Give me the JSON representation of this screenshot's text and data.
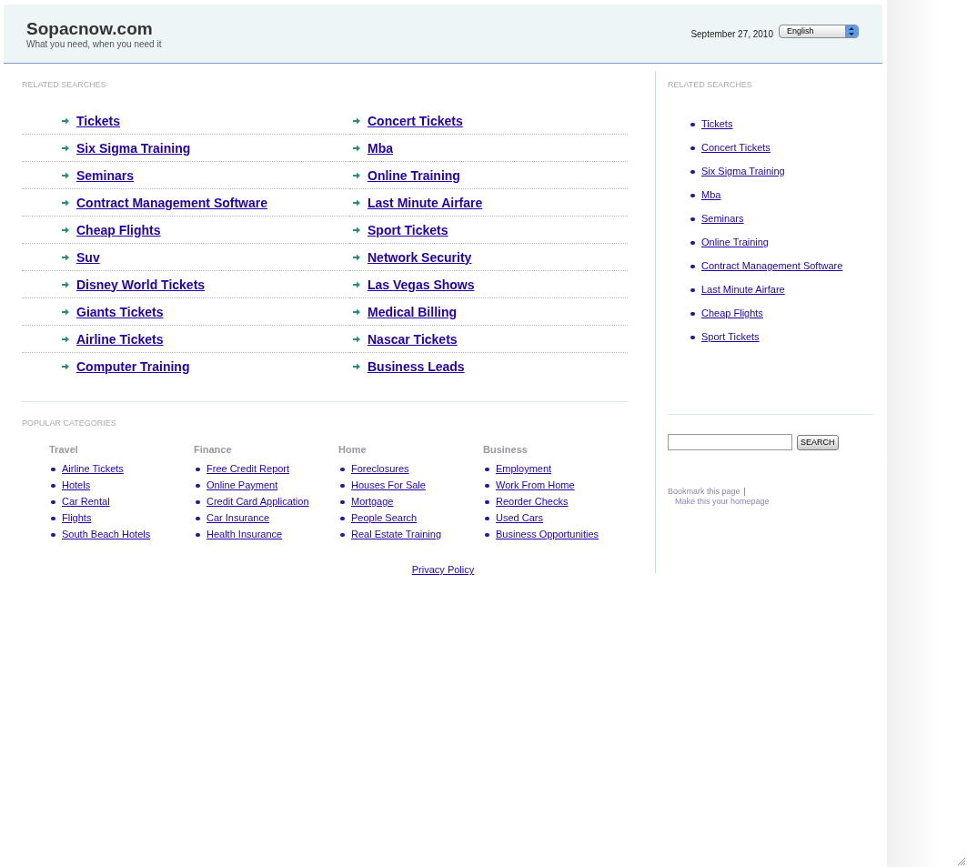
{
  "header": {
    "site_title": "Sopacnow.com",
    "tagline": "What you need, when you need it",
    "date": "September 27, 2010",
    "language_select": "English"
  },
  "related_searches": {
    "heading": "RELATED SEARCHES",
    "links": [
      "Tickets",
      "Concert Tickets",
      "Six Sigma Training",
      "Mba",
      "Seminars",
      "Online Training",
      "Contract Management Software",
      "Last Minute Airfare",
      "Cheap Flights",
      "Sport Tickets",
      "Suv",
      "Network Security",
      "Disney World Tickets",
      "Las Vegas Shows",
      "Giants Tickets",
      "Medical Billing",
      "Airline Tickets",
      "Nascar Tickets",
      "Computer Training",
      "Business Leads"
    ]
  },
  "popular_categories": {
    "heading": "POPULAR CATEGORIES",
    "columns": [
      {
        "title": "Travel",
        "links": [
          "Airline Tickets",
          "Hotels",
          "Car Rental",
          "Flights",
          "South Beach Hotels"
        ]
      },
      {
        "title": "Finance",
        "links": [
          "Free Credit Report",
          "Online Payment",
          "Credit Card Application",
          "Car Insurance",
          "Health Insurance"
        ]
      },
      {
        "title": "Home",
        "links": [
          "Foreclosures",
          "Houses For Sale",
          "Mortgage",
          "People Search",
          "Real Estate Training"
        ]
      },
      {
        "title": "Business",
        "links": [
          "Employment",
          "Work From Home",
          "Reorder Checks",
          "Used Cars",
          "Business Opportunities"
        ]
      }
    ]
  },
  "footer": {
    "privacy_link": "Privacy Policy"
  },
  "sidebar": {
    "heading": "RELATED SEARCHES",
    "links": [
      "Tickets",
      "Concert Tickets",
      "Six Sigma Training",
      "Mba",
      "Seminars",
      "Online Training",
      "Contract Management Software",
      "Last Minute Airfare",
      "Cheap Flights",
      "Sport Tickets"
    ],
    "search_button": "SEARCH",
    "bookmark_link": "Bookmark this page",
    "separator": "|",
    "homepage_link": "Make this your homepage"
  }
}
